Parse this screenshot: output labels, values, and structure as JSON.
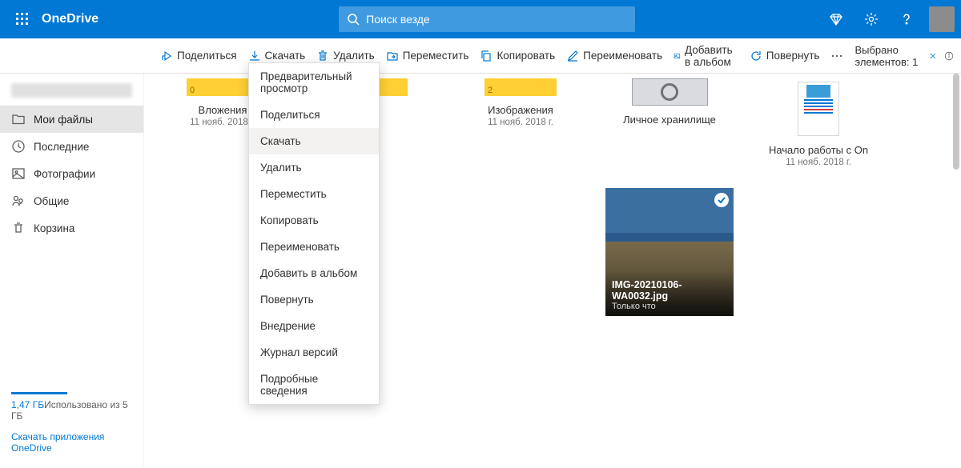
{
  "header": {
    "brand": "OneDrive",
    "search_placeholder": "Поиск везде"
  },
  "toolbar": {
    "share": "Поделиться",
    "download": "Скачать",
    "delete": "Удалить",
    "move": "Переместить",
    "copy": "Копировать",
    "rename": "Переименовать",
    "album": "Добавить в альбом",
    "rotate": "Повернуть",
    "selected": "Выбрано элементов: 1"
  },
  "sidebar": {
    "items": [
      {
        "label": "Мои файлы"
      },
      {
        "label": "Последние"
      },
      {
        "label": "Фотографии"
      },
      {
        "label": "Общие"
      },
      {
        "label": "Корзина"
      }
    ],
    "storage_used": "1,47 ГБ",
    "storage_text": "Использовано из 5 ГБ",
    "app_link": "Скачать приложения OneDrive"
  },
  "files": {
    "row1": [
      {
        "name": "Вложения",
        "date": "11 нояб. 2018 г.",
        "count": "0"
      },
      {
        "name": "",
        "date": ""
      },
      {
        "name": "Изображения",
        "date": "11 нояб. 2018 г.",
        "count": "2"
      },
      {
        "name": "Личное хранилище",
        "date": ""
      }
    ],
    "doc": {
      "name": "Начало работы с On",
      "date": "11 нояб. 2018 г."
    },
    "photo": {
      "name": "IMG-20210106-WA0032.jpg",
      "date": "Только что"
    }
  },
  "context_menu": [
    "Предварительный просмотр",
    "Поделиться",
    "Скачать",
    "Удалить",
    "Переместить",
    "Копировать",
    "Переименовать",
    "Добавить в альбом",
    "Повернуть",
    "Внедрение",
    "Журнал версий",
    "Подробные сведения"
  ]
}
